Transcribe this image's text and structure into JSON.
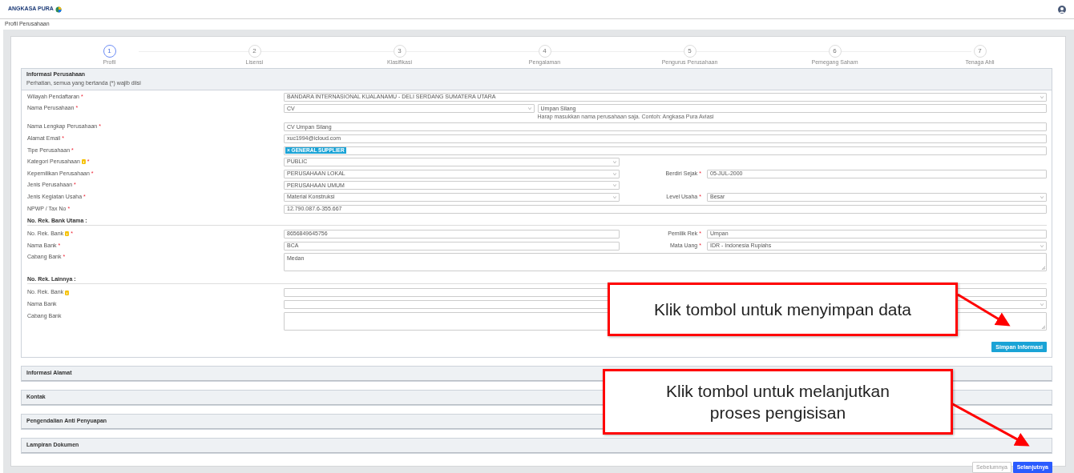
{
  "header": {
    "logo_text": "ANGKASA PURA"
  },
  "breadcrumb": "Profil Perusahaan",
  "steps": [
    {
      "number": "1",
      "label": "Profil",
      "selected": true
    },
    {
      "number": "2",
      "label": "Lisensi",
      "selected": false
    },
    {
      "number": "3",
      "label": "Klasifikasi",
      "selected": false
    },
    {
      "number": "4",
      "label": "Pengalaman",
      "selected": false
    },
    {
      "number": "5",
      "label": "Pengurus Perusahaan",
      "selected": false
    },
    {
      "number": "6",
      "label": "Pemegang Saham",
      "selected": false
    },
    {
      "number": "7",
      "label": "Tenaga Ahli",
      "selected": false
    }
  ],
  "sections": [
    {
      "title": "Informasi Perusahaan",
      "note": "Perhatian, semua yang bertanda (*) wajib diisi",
      "expanded": true,
      "rows": [
        {
          "kind": "wide",
          "label": "Wilayah Pendaftaran",
          "required_mark": "*",
          "field": {
            "kind": "select",
            "value": "BANDARA INTERNASIONAL KUALANAMU - DELI SERDANG SUMATERA UTARA"
          }
        },
        {
          "kind": "combo",
          "label": "Nama Perusahaan",
          "required_mark": "*",
          "field": {
            "kind": "select",
            "value": "CV"
          },
          "extra": {
            "kind": "input",
            "value": "Umpan Silang"
          },
          "hint": "Harap masukkan nama perusahaan saja. Contoh: Angkasa Pura Aviasi"
        },
        {
          "kind": "wide",
          "label": "Nama Lengkap Perusahaan",
          "required_mark": "*",
          "field": {
            "kind": "input",
            "value": "CV Umpan Silang"
          }
        },
        {
          "kind": "wide",
          "label": "Alamat Email",
          "required_mark": "*",
          "field": {
            "kind": "input",
            "value": "xuc1994@icloud.com"
          }
        },
        {
          "kind": "wide",
          "label": "Tipe Perusahaan",
          "required_mark": "*",
          "field": {
            "kind": "tags",
            "tags": [
              "× GENERAL SUPPLIER"
            ]
          }
        },
        {
          "kind": "split",
          "label": "Kategori Perusahaan",
          "info": true,
          "required_mark": "*",
          "field": {
            "kind": "select",
            "value": "PUBLIC"
          }
        },
        {
          "kind": "split",
          "label": "Kepemilikan Perusahaan",
          "required_mark": "*",
          "field": {
            "kind": "select",
            "value": "PERUSAHAAN LOKAL"
          },
          "right": {
            "label": "Berdiri Sejak",
            "required_mark": "*",
            "field": {
              "kind": "input",
              "value": "05-JUL-2000"
            }
          }
        },
        {
          "kind": "split",
          "label": "Jenis Perusahaan",
          "required_mark": "*",
          "field": {
            "kind": "select",
            "value": "PERUSAHAAN UMUM"
          }
        },
        {
          "kind": "split",
          "label": "Jenis Kegiatan Usaha",
          "required_mark": "*",
          "field": {
            "kind": "select",
            "value": "Material Konstruksi"
          },
          "right": {
            "label": "Level Usaha",
            "required_mark": "*",
            "field": {
              "kind": "select",
              "value": "Besar"
            }
          }
        },
        {
          "kind": "wide",
          "label": "NPWP / Tax No",
          "required_mark": "*",
          "field": {
            "kind": "input",
            "value": "12.790.087.6-355.667"
          }
        },
        {
          "kind": "heading",
          "label": "No. Rek. Bank Utama :"
        },
        {
          "kind": "split",
          "label": "No. Rek. Bank",
          "info": true,
          "required_mark": "*",
          "field": {
            "kind": "input",
            "value": "8656849645756"
          },
          "right": {
            "label": "Pemilik Rek",
            "required_mark": "*",
            "field": {
              "kind": "input",
              "value": "Umpan"
            }
          }
        },
        {
          "kind": "split",
          "label": "Nama Bank",
          "required_mark": "*",
          "field": {
            "kind": "input",
            "value": "BCA"
          },
          "right": {
            "label": "Mata Uang",
            "required_mark": "*",
            "field": {
              "kind": "select",
              "value": "IDR - Indonesia Rupiahs"
            }
          }
        },
        {
          "kind": "wide",
          "label": "Cabang Bank",
          "required_mark": "*",
          "field": {
            "kind": "textarea",
            "value": "Medan"
          }
        },
        {
          "kind": "heading",
          "label": "No. Rek. Lainnya :"
        },
        {
          "kind": "wide",
          "label": "No. Rek. Bank",
          "info": true,
          "field": {
            "kind": "input"
          }
        },
        {
          "kind": "wide",
          "label": "Nama Bank",
          "field": {
            "kind": "select"
          }
        },
        {
          "kind": "wide",
          "label": "Cabang Bank",
          "field": {
            "kind": "textarea"
          }
        }
      ],
      "save_button": "Simpan Informasi"
    },
    {
      "title": "Informasi Alamat",
      "expanded": false
    },
    {
      "title": "Kontak",
      "expanded": false
    },
    {
      "title": "Pengendalian Anti Penyuapan",
      "expanded": false
    },
    {
      "title": "Lampiran Dokumen",
      "expanded": false
    }
  ],
  "footer_buttons": [
    {
      "label": "Sebelumnya",
      "kind": "secondary"
    },
    {
      "label": "Selanjutnya",
      "kind": "primary"
    }
  ],
  "callouts": [
    {
      "text": "Klik tombol untuk menyimpan data"
    },
    {
      "text": "Klik tombol untuk melanjutkan proses pengisisan"
    }
  ]
}
